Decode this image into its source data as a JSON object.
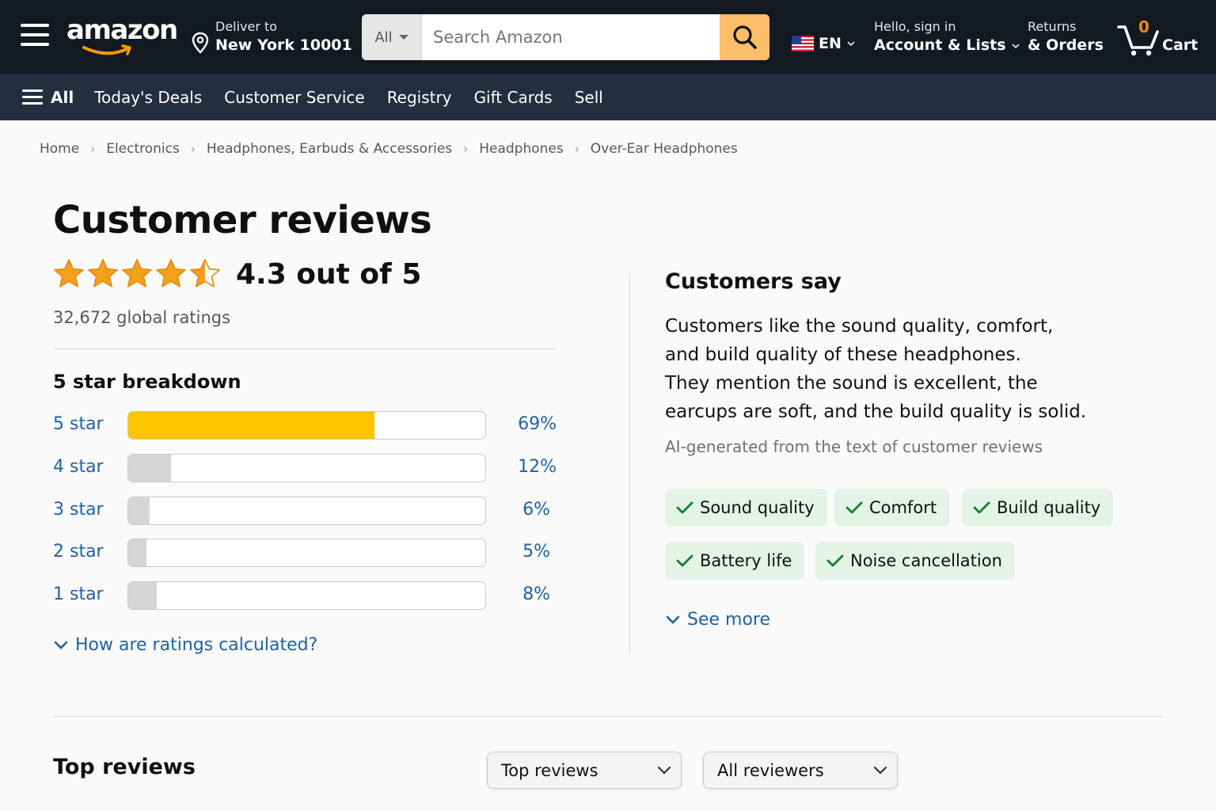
{
  "header": {
    "logo_text": "amazon",
    "deliver_line1": "Deliver to",
    "deliver_line2": "New York 10001",
    "search_category": "All",
    "search_placeholder": "Search Amazon",
    "language": "EN",
    "account_line1": "Hello, sign in",
    "account_line2": "Account & Lists",
    "returns_line1": "Returns",
    "returns_line2": "& Orders",
    "cart_count": "0",
    "cart_label": "Cart"
  },
  "subnav": {
    "all_label": "All",
    "links": [
      "Today's Deals",
      "Customer Service",
      "Registry",
      "Gift Cards",
      "Sell"
    ]
  },
  "breadcrumb": [
    "Home",
    "Electronics",
    "Headphones, Earbuds & Accessories",
    "Headphones",
    "Over-Ear Headphones"
  ],
  "reviews": {
    "title": "Customer reviews",
    "rating_value": 4.3,
    "average_text": "4.3 out of 5",
    "total_ratings": "32,672 global ratings",
    "breakdown_title": "5 star breakdown",
    "histogram": [
      {
        "label": "5 star",
        "percent_text": "69%",
        "percent": 69
      },
      {
        "label": "4 star",
        "percent_text": "12%",
        "percent": 12
      },
      {
        "label": "3 star",
        "percent_text": "6%",
        "percent": 6
      },
      {
        "label": "2 star",
        "percent_text": "5%",
        "percent": 5
      },
      {
        "label": "1 star",
        "percent_text": "8%",
        "percent": 8
      }
    ],
    "how_calculated": "How are ratings calculated?"
  },
  "customers_say": {
    "title": "Customers say",
    "summary_lines": [
      "Customers like the sound quality, comfort,",
      "and build quality of these headphones.",
      "They mention the sound is excellent, the",
      "earcups are soft, and the build quality is solid."
    ],
    "note": "AI-generated from the text of customer reviews",
    "aspects": [
      "Sound quality",
      "Comfort",
      "Build quality",
      "Battery life",
      "Noise cancellation"
    ],
    "see_more": "See more"
  },
  "top_reviews": {
    "title": "Top reviews",
    "sort_selected": "Top reviews",
    "filter_selected": "All reviewers"
  },
  "colors": {
    "header_bg": "#131921",
    "subnav_bg": "#232f3e",
    "search_button": "#febd69",
    "star": "#f5a01a",
    "bar_fill": "#ffc400",
    "link": "#2162a1",
    "chip_bg": "#e3f3e6",
    "check": "#1a7a32"
  }
}
